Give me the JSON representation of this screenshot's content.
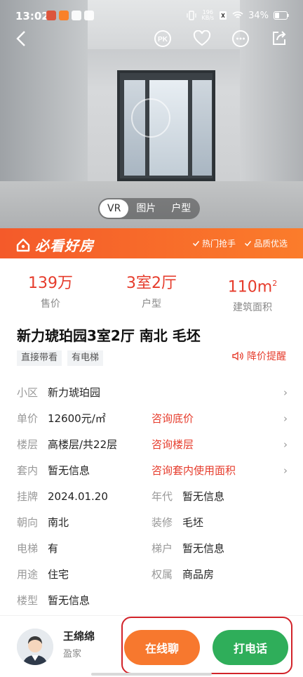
{
  "status_bar": {
    "time": "13:02",
    "network_speed_value": "196",
    "network_speed_unit": "KB/s",
    "battery": "34%"
  },
  "media_tabs": [
    "VR",
    "图片",
    "户型"
  ],
  "banner": {
    "title": "必看好房",
    "tag1": "热门抢手",
    "tag2": "品质优选"
  },
  "stats": {
    "price": "139万",
    "price_label": "售价",
    "layout": "3室2厅",
    "layout_label": "户型",
    "area": "110m",
    "area_unit_sup": "2",
    "area_label": "建筑面积"
  },
  "title": "新力琥珀园3室2厅 南北 毛坯",
  "tags": [
    "直接带看",
    "有电梯"
  ],
  "price_alert": "降价提醒",
  "details": {
    "community_k": "小区",
    "community_v": "新力琥珀园",
    "unit_price_k": "单价",
    "unit_price_v": "12600元/㎡",
    "unit_price_link": "咨询底价",
    "floor_k": "楼层",
    "floor_v": "高楼层/共22层",
    "floor_link": "咨询楼层",
    "inner_k": "套内",
    "inner_v": "暂无信息",
    "inner_link": "咨询套内使用面积",
    "listing_k": "挂牌",
    "listing_v": "2024.01.20",
    "year_k": "年代",
    "year_v": "暂无信息",
    "orientation_k": "朝向",
    "orientation_v": "南北",
    "decoration_k": "装修",
    "decoration_v": "毛坯",
    "elevator_k": "电梯",
    "elevator_v": "有",
    "ladder_k": "梯户",
    "ladder_v": "暂无信息",
    "usage_k": "用途",
    "usage_v": "住宅",
    "ownership_k": "权属",
    "ownership_v": "商品房",
    "building_k": "楼型",
    "building_v": "暂无信息"
  },
  "agent": {
    "name": "王绵绵",
    "company": "盈家"
  },
  "buttons": {
    "chat": "在线聊",
    "call": "打电话"
  },
  "colors": {
    "accent_red": "#e63c2c",
    "chat_orange": "#f7782e",
    "call_green": "#2fae5a",
    "highlight_red": "#d2232a"
  }
}
